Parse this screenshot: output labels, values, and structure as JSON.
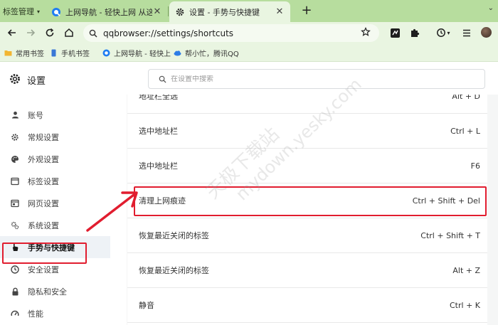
{
  "browser": {
    "tab_group_label": "标签管理",
    "tabs": [
      {
        "title": "上网导航 - 轻快上网 从这里开始",
        "active": false
      },
      {
        "title": "设置 - 手势与快捷键",
        "active": true
      }
    ],
    "url": "qqbrowser://settings/shortcuts",
    "bookmarks": [
      {
        "label": "常用书签",
        "icon": "folder-icon"
      },
      {
        "label": "手机书签",
        "icon": "phone-bookmark-icon"
      },
      {
        "label": "上网导航 - 轻快上",
        "icon": "qq-browser-icon"
      },
      {
        "label": "帮小忙，腾讯QQ",
        "icon": "cloud-icon"
      }
    ]
  },
  "settings": {
    "title": "设置",
    "search_placeholder": "在设置中搜索",
    "sidebar": [
      {
        "label": "账号",
        "icon": "person-icon",
        "active": false
      },
      {
        "label": "常规设置",
        "icon": "gear-icon",
        "active": false
      },
      {
        "label": "外观设置",
        "icon": "palette-icon",
        "active": false
      },
      {
        "label": "标签设置",
        "icon": "tab-icon",
        "active": false
      },
      {
        "label": "网页设置",
        "icon": "webpage-icon",
        "active": false
      },
      {
        "label": "系统设置",
        "icon": "system-gears-icon",
        "active": false
      },
      {
        "label": "手势与快捷键",
        "icon": "hand-pointer-icon",
        "active": true
      },
      {
        "label": "安全设置",
        "icon": "shield-icon",
        "active": false
      },
      {
        "label": "隐私和安全",
        "icon": "lock-icon",
        "active": false
      },
      {
        "label": "性能",
        "icon": "performance-icon",
        "active": false
      }
    ],
    "shortcuts": [
      {
        "action": "地址栏全选",
        "key": "Alt + D"
      },
      {
        "action": "选中地址栏",
        "key": "Ctrl + L"
      },
      {
        "action": "选中地址栏",
        "key": "F6"
      },
      {
        "action": "清理上网痕迹",
        "key": "Ctrl + Shift + Del",
        "highlighted": true
      },
      {
        "action": "恢复最近关闭的标签",
        "key": "Ctrl + Shift + T"
      },
      {
        "action": "恢复最近关闭的标签",
        "key": "Alt + Z"
      },
      {
        "action": "静音",
        "key": "Ctrl + K"
      }
    ]
  },
  "watermark": {
    "line1": "天极下载站",
    "line2": "mydown.yesky.com"
  },
  "colors": {
    "tabstrip": "#b7dd9e",
    "toolbar": "#e9f5e1",
    "annotation_red": "#e11d2f"
  }
}
